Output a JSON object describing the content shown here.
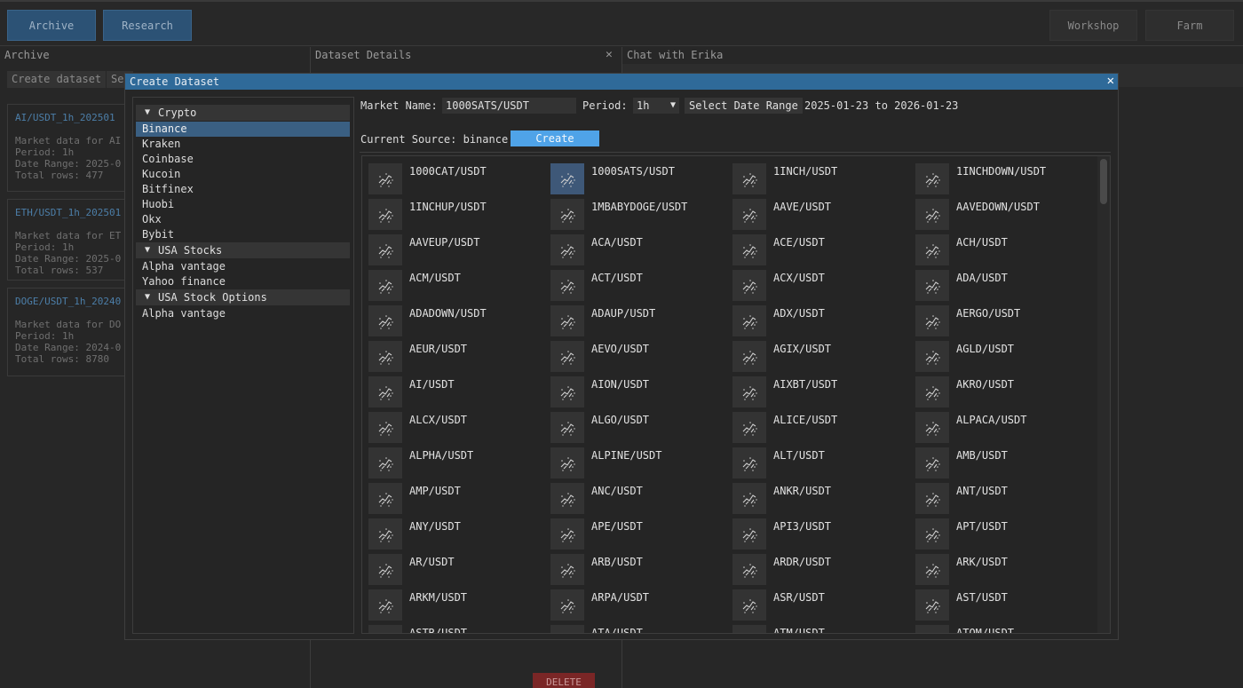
{
  "top": {
    "archive_label": "Archive",
    "research_label": "Research",
    "workshop_label": "Workshop",
    "farm_label": "Farm"
  },
  "panels": {
    "archive_title": "Archive",
    "details_title": "Dataset Details",
    "details_close": "✕",
    "chat_title": "Chat with Erika"
  },
  "archive": {
    "create_label": "Create dataset",
    "search_label": "Se",
    "cards": [
      {
        "title": "AI/USDT_1h_202501",
        "desc": "Market data for AI",
        "period": "Period: 1h",
        "range": "Date Range: 2025-0",
        "rows": "Total rows: 477"
      },
      {
        "title": "ETH/USDT_1h_202501",
        "desc": "Market data for ET",
        "period": "Period: 1h",
        "range": "Date Range: 2025-0",
        "rows": "Total rows: 537"
      },
      {
        "title": "DOGE/USDT_1h_20240",
        "desc": "Market data for DO",
        "period": "Period: 1h",
        "range": "Date Range: 2024-0",
        "rows": "Total rows: 8780"
      }
    ],
    "delete_label": "DELETE"
  },
  "modal": {
    "title": "Create Dataset",
    "close": "✕",
    "tree": [
      {
        "group": "Crypto",
        "items": [
          "Binance",
          "Kraken",
          "Coinbase",
          "Kucoin",
          "Bitfinex",
          "Huobi",
          "Okx",
          "Bybit"
        ],
        "selected": "Binance"
      },
      {
        "group": "USA Stocks",
        "items": [
          "Alpha vantage",
          "Yahoo finance"
        ]
      },
      {
        "group": "USA Stock Options",
        "items": [
          "Alpha vantage"
        ]
      }
    ],
    "market_label": "Market Name:",
    "market_value": "1000SATS/USDT",
    "period_label": "Period:",
    "period_value": "1h",
    "date_btn": "Select Date Range",
    "date_range": "2025-01-23 to 2026-01-23",
    "source_label": "Current Source: binance",
    "create_label": "Create",
    "selected_market": "1000SATS/USDT",
    "markets": [
      "1000CAT/USDT",
      "1000SATS/USDT",
      "1INCH/USDT",
      "1INCHDOWN/USDT",
      "1INCHUP/USDT",
      "1MBABYDOGE/USDT",
      "AAVE/USDT",
      "AAVEDOWN/USDT",
      "AAVEUP/USDT",
      "ACA/USDT",
      "ACE/USDT",
      "ACH/USDT",
      "ACM/USDT",
      "ACT/USDT",
      "ACX/USDT",
      "ADA/USDT",
      "ADADOWN/USDT",
      "ADAUP/USDT",
      "ADX/USDT",
      "AERGO/USDT",
      "AEUR/USDT",
      "AEVO/USDT",
      "AGIX/USDT",
      "AGLD/USDT",
      "AI/USDT",
      "AION/USDT",
      "AIXBT/USDT",
      "AKRO/USDT",
      "ALCX/USDT",
      "ALGO/USDT",
      "ALICE/USDT",
      "ALPACA/USDT",
      "ALPHA/USDT",
      "ALPINE/USDT",
      "ALT/USDT",
      "AMB/USDT",
      "AMP/USDT",
      "ANC/USDT",
      "ANKR/USDT",
      "ANT/USDT",
      "ANY/USDT",
      "APE/USDT",
      "API3/USDT",
      "APT/USDT",
      "AR/USDT",
      "ARB/USDT",
      "ARDR/USDT",
      "ARK/USDT",
      "ARKM/USDT",
      "ARPA/USDT",
      "ASR/USDT",
      "AST/USDT",
      "ASTR/USDT",
      "ATA/USDT",
      "ATM/USDT",
      "ATOM/USDT"
    ]
  }
}
